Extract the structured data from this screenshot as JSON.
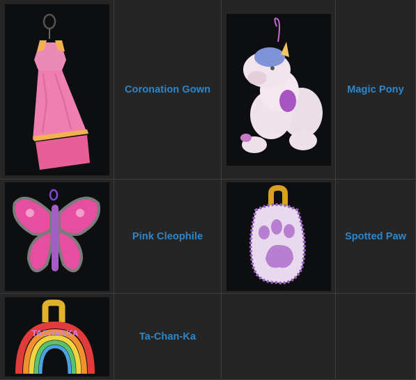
{
  "items": [
    {
      "name": "Coronation Gown",
      "icon": "gown-charm-icon"
    },
    {
      "name": "Magic Pony",
      "icon": "unicorn-charm-icon"
    },
    {
      "name": "Pink Cleophile",
      "icon": "butterfly-charm-icon"
    },
    {
      "name": "Spotted Paw",
      "icon": "paw-charm-icon"
    },
    {
      "name": "Ta-Chan-Ka",
      "icon": "rainbow-charm-icon"
    }
  ],
  "rainbow_text": "TACHANKA",
  "colors": {
    "name_text": "#2f86c9",
    "cell_bg": "#252525",
    "thumb_bg": "#0d0e10",
    "grid_line": "#3a3a3a"
  }
}
